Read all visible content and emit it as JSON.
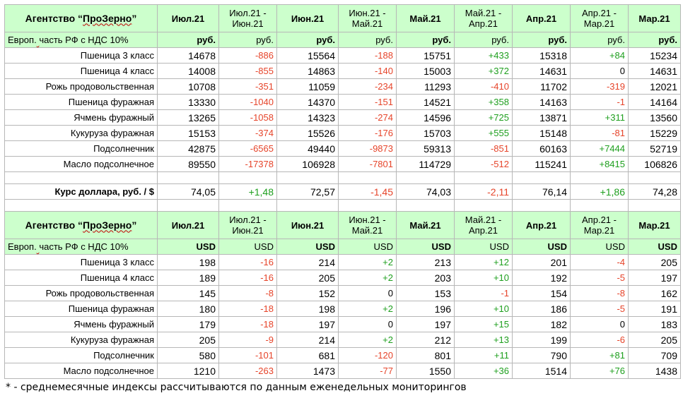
{
  "agency": "Агентство “ПроЗерно”",
  "region_label": "Европ. часть РФ с НДС 10%",
  "columns": [
    {
      "type": "month",
      "label": "Июл.21"
    },
    {
      "type": "diff",
      "label": "Июл.21 - Июн.21"
    },
    {
      "type": "month",
      "label": "Июн.21"
    },
    {
      "type": "diff",
      "label": "Июн.21 - Май.21"
    },
    {
      "type": "month",
      "label": "Май.21"
    },
    {
      "type": "diff",
      "label": "Май.21 - Апр.21"
    },
    {
      "type": "month",
      "label": "Апр.21"
    },
    {
      "type": "diff",
      "label": "Апр.21 - Мар.21"
    },
    {
      "type": "month",
      "label": "Мар.21"
    }
  ],
  "sections": [
    {
      "unit": "руб.",
      "rows": [
        {
          "name": "Пшеница 3 класс",
          "values": [
            "14678",
            "-886",
            "15564",
            "-188",
            "15751",
            "+433",
            "15318",
            "+84",
            "15234"
          ]
        },
        {
          "name": "Пшеница 4 класс",
          "values": [
            "14008",
            "-855",
            "14863",
            "-140",
            "15003",
            "+372",
            "14631",
            "0",
            "14631"
          ]
        },
        {
          "name": "Рожь продовольственная",
          "values": [
            "10708",
            "-351",
            "11059",
            "-234",
            "11293",
            "-410",
            "11702",
            "-319",
            "12021"
          ]
        },
        {
          "name": "Пшеница фуражная",
          "values": [
            "13330",
            "-1040",
            "14370",
            "-151",
            "14521",
            "+358",
            "14163",
            "-1",
            "14164"
          ]
        },
        {
          "name": "Ячмень фуражный",
          "values": [
            "13265",
            "-1058",
            "14323",
            "-274",
            "14596",
            "+725",
            "13871",
            "+311",
            "13560"
          ]
        },
        {
          "name": "Кукуруза фуражная",
          "values": [
            "15153",
            "-374",
            "15526",
            "-176",
            "15703",
            "+555",
            "15148",
            "-81",
            "15229"
          ]
        },
        {
          "name": "Подсолнечник",
          "values": [
            "42875",
            "-6565",
            "49440",
            "-9873",
            "59313",
            "-851",
            "60163",
            "+7444",
            "52719"
          ]
        },
        {
          "name": "Масло подсолнечное",
          "values": [
            "89550",
            "-17378",
            "106928",
            "-7801",
            "114729",
            "-512",
            "115241",
            "+8415",
            "106826"
          ]
        }
      ]
    },
    {
      "unit": "USD",
      "rows": [
        {
          "name": "Пшеница 3 класс",
          "values": [
            "198",
            "-16",
            "214",
            "+2",
            "213",
            "+12",
            "201",
            "-4",
            "205"
          ]
        },
        {
          "name": "Пшеница 4 класс",
          "values": [
            "189",
            "-16",
            "205",
            "+2",
            "203",
            "+10",
            "192",
            "-5",
            "197"
          ]
        },
        {
          "name": "Рожь продовольственная",
          "values": [
            "145",
            "-8",
            "152",
            "0",
            "153",
            "-1",
            "154",
            "-8",
            "162"
          ]
        },
        {
          "name": "Пшеница фуражная",
          "values": [
            "180",
            "-18",
            "198",
            "+2",
            "196",
            "+10",
            "186",
            "-5",
            "191"
          ]
        },
        {
          "name": "Ячмень фуражный",
          "values": [
            "179",
            "-18",
            "197",
            "0",
            "197",
            "+15",
            "182",
            "0",
            "183"
          ]
        },
        {
          "name": "Кукуруза фуражная",
          "values": [
            "205",
            "-9",
            "214",
            "+2",
            "212",
            "+13",
            "199",
            "-6",
            "205"
          ]
        },
        {
          "name": "Подсолнечник",
          "values": [
            "580",
            "-101",
            "681",
            "-120",
            "801",
            "+11",
            "790",
            "+81",
            "709"
          ]
        },
        {
          "name": "Масло подсолнечное",
          "values": [
            "1210",
            "-263",
            "1473",
            "-77",
            "1550",
            "+36",
            "1514",
            "+76",
            "1438"
          ]
        }
      ]
    }
  ],
  "rate": {
    "label": "Курс доллара, руб. / $",
    "values": [
      "74,05",
      "+1,48",
      "72,57",
      "-1,45",
      "74,03",
      "-2,11",
      "76,14",
      "+1,86",
      "74,28"
    ]
  },
  "footnote": "* - среднемесячные индексы рассчитываются по данным еженедельных мониторингов",
  "colors": {
    "header_bg": "#ccffcc",
    "negative": "#e6442a",
    "positive": "#1e9f1e"
  }
}
